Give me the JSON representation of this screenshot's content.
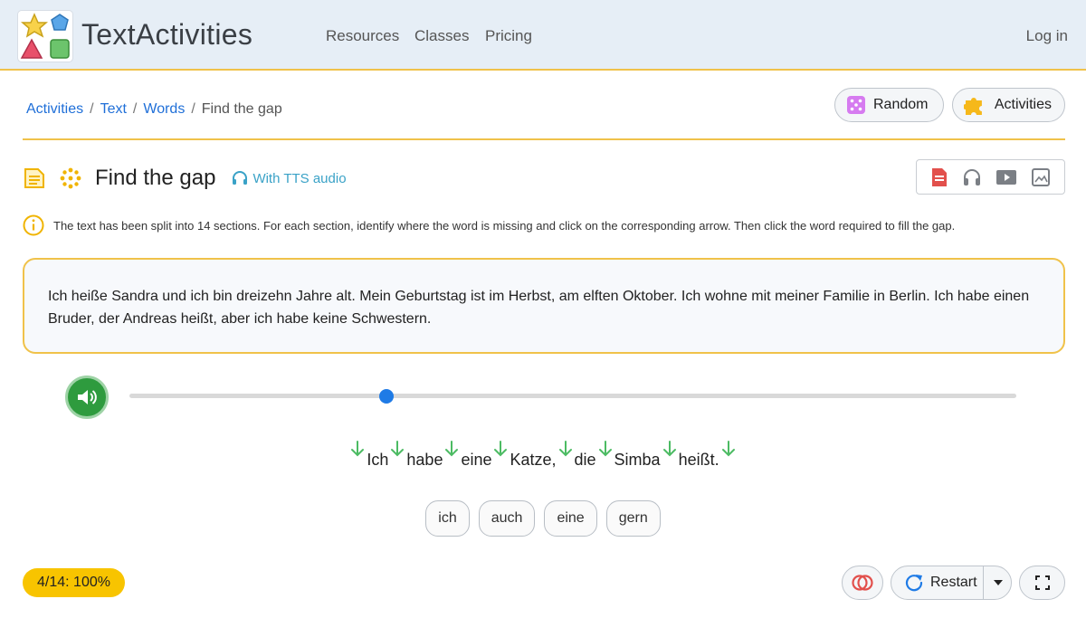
{
  "header": {
    "brand": "TextActivities",
    "nav": [
      "Resources",
      "Classes",
      "Pricing"
    ],
    "login": "Log in"
  },
  "breadcrumb": {
    "items": [
      "Activities",
      "Text",
      "Words"
    ],
    "current": "Find the gap"
  },
  "toolbar": {
    "random_label": "Random",
    "activities_label": "Activities"
  },
  "activity": {
    "title": "Find the gap",
    "tts_label": "With TTS audio",
    "instructions": "The text has been split into 14 sections. For each section, identify where the word is missing and click on the corresponding arrow. Then click the word required to fill the gap.",
    "passage": "Ich heiße Sandra und ich bin dreizehn Jahre alt. Mein Geburtstag ist im Herbst, am elften Oktober. Ich wohne mit meiner Familie in Berlin. Ich habe einen Bruder, der Andreas heißt, aber ich habe keine Schwestern.",
    "sentence_words": [
      "Ich",
      "habe",
      "eine",
      "Katze,",
      "die",
      "Simba",
      "heißt."
    ],
    "choices": [
      "ich",
      "auch",
      "eine",
      "gern"
    ],
    "audio_progress": 0.29
  },
  "footer": {
    "score": "4/14: 100%",
    "restart_label": "Restart"
  },
  "colors": {
    "accent": "#f0c24a",
    "link": "#1f6fd8",
    "play": "#2e9b3e",
    "arrow": "#4cbb63",
    "score": "#f8c400"
  },
  "icons": {
    "random": "dice-icon",
    "activities": "puzzle-icon",
    "tts": "headphones-icon",
    "info": "info-icon",
    "play": "speaker-icon",
    "restart": "refresh-icon",
    "fullscreen": "fullscreen-icon"
  }
}
